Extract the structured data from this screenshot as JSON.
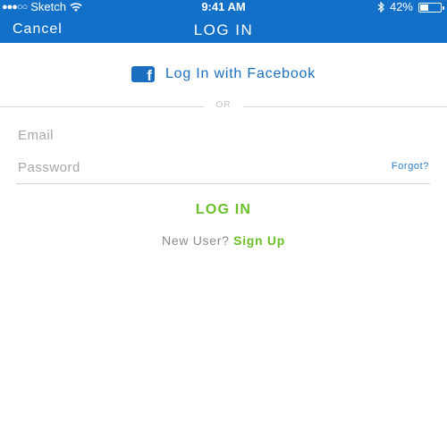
{
  "status_bar": {
    "signal": "●●●○○",
    "carrier": "Sketch",
    "time": "9:41 AM",
    "battery_percent_label": "42%",
    "battery_level": 0.42,
    "icons": [
      "wifi-icon",
      "bluetooth-icon",
      "battery-icon"
    ]
  },
  "nav": {
    "cancel_label": "Cancel",
    "title": "LOG IN"
  },
  "facebook": {
    "icon_glyph": "f",
    "label": "Log In with Facebook"
  },
  "divider": {
    "label": "OR"
  },
  "form": {
    "email_placeholder": "Email",
    "email_value": "",
    "password_placeholder": "Password",
    "password_value": "",
    "forgot_label": "Forgot?"
  },
  "actions": {
    "login_label": "LOG IN",
    "new_user_prompt": "New User?",
    "signup_label": "Sign Up"
  },
  "colors": {
    "nav_blue": "#1370c8",
    "facebook_blue": "#1b6fc1",
    "accent_green": "#6bbf2a",
    "link_blue": "#2a7cc7"
  }
}
